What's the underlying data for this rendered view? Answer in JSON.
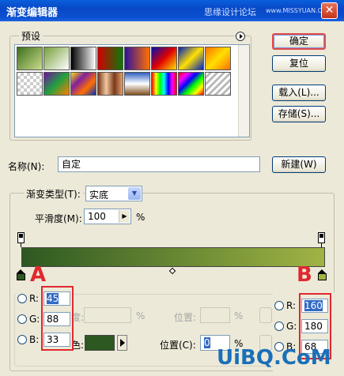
{
  "window": {
    "title": "渐变编辑器",
    "watermark": "思缘设计论坛",
    "watermark_url": "www.MISSYUAN.COM",
    "close_glyph": "✕"
  },
  "presets": {
    "label": "预设",
    "swatches": [
      {
        "name": "fg-to-bg",
        "bg": "linear-gradient(135deg,#3f6e1f,#c9dd8a)"
      },
      {
        "name": "fg-to-transparent",
        "bg": "linear-gradient(135deg,rgba(120,160,60,1),rgba(120,160,60,0))"
      },
      {
        "name": "black-white",
        "bg": "linear-gradient(90deg,#000,#fff)"
      },
      {
        "name": "red-green",
        "bg": "linear-gradient(90deg,#d00000,#0a7a0a)"
      },
      {
        "name": "violet-orange",
        "bg": "linear-gradient(90deg,#3010a0,#ff7000)"
      },
      {
        "name": "blue-red-yellow",
        "bg": "linear-gradient(135deg,#0010b0,#e00000,#ffe000)"
      },
      {
        "name": "blue-yellow-blue",
        "bg": "linear-gradient(135deg,#0020c0,#ffe000,#0020c0)"
      },
      {
        "name": "orange-yellow-orange",
        "bg": "linear-gradient(135deg,#ff7000,#ffe000,#ff7000)"
      },
      {
        "name": "transparent-empty",
        "bg": "checker"
      },
      {
        "name": "violet-green-orange",
        "bg": "linear-gradient(135deg,#7010a0,#20a040,#ff8000)"
      },
      {
        "name": "yellow-violet-orange-blue",
        "bg": "linear-gradient(135deg,#ffe000,#8020a0,#ff7000,#0030c0)"
      },
      {
        "name": "copper",
        "bg": "linear-gradient(90deg,#7a3a1a,#f0c8a0,#7a3a1a,#e0a070)"
      },
      {
        "name": "chrome",
        "bg": "linear-gradient(180deg,#3060c0,#ffffff 50%,#805020)"
      },
      {
        "name": "spectrum",
        "bg": "linear-gradient(90deg,#ff0000,#ffff00,#00ff00,#00ffff,#0000ff,#ff00ff,#ff0000)"
      },
      {
        "name": "transparent-rainbow",
        "bg": "linear-gradient(135deg,#ff0000,#ff00ff,#0000ff,#00ff00,#ffff00,#ff0000)"
      },
      {
        "name": "transparent-stripes",
        "bg": "repeating-linear-gradient(135deg,#ffffff 0 3px,#b8b8b8 3px 6px)"
      }
    ]
  },
  "buttons": {
    "ok": "确定",
    "reset": "复位",
    "load": "载入(L)...",
    "save": "存储(S)...",
    "new": "新建(W)"
  },
  "name_field": {
    "label": "名称(N):",
    "value": "自定"
  },
  "gradient_type": {
    "label": "渐变类型(T):",
    "value": "实底",
    "smoothness_label": "平滑度(M):",
    "smoothness_value": "100",
    "percent": "%"
  },
  "gradient": {
    "start_color": "#2d5821",
    "end_color": "#a0b444",
    "annotation_left": "A",
    "annotation_right": "B"
  },
  "color_stop_a": {
    "r_label": "R:",
    "r_value": "45",
    "g_label": "G:",
    "g_value": "88",
    "b_label": "B:",
    "b_value": "33"
  },
  "color_stop_b": {
    "r_label": "R:",
    "r_value": "160",
    "g_label": "G:",
    "g_value": "180",
    "b_label": "B:",
    "b_value": "68"
  },
  "stops_section": {
    "opacity_fragment": "度:",
    "percent": "%",
    "location_label": "位置:",
    "color_fragment": "色:",
    "location_c_label": "位置(C):",
    "location_c_value": "0"
  },
  "logo": "UiBQ.CoM"
}
